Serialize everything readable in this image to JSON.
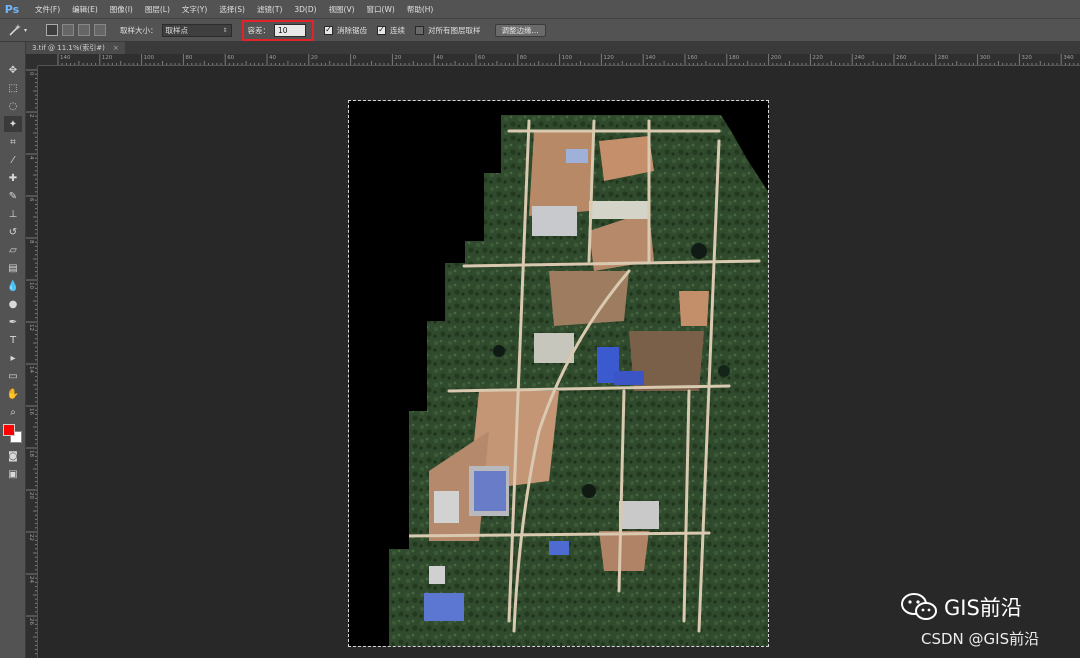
{
  "app": {
    "logo": "Ps"
  },
  "menu": [
    "文件(F)",
    "编辑(E)",
    "图像(I)",
    "图层(L)",
    "文字(Y)",
    "选择(S)",
    "滤镜(T)",
    "3D(D)",
    "视图(V)",
    "窗口(W)",
    "帮助(H)"
  ],
  "options": {
    "tool_icon": "magic-wand-icon",
    "sample_size_label": "取样大小：",
    "sample_size_value": "取样点",
    "tolerance_label": "容差：",
    "tolerance_value": "10",
    "antialias_label": "消除锯齿",
    "antialias_checked": true,
    "contiguous_label": "连续",
    "contiguous_checked": true,
    "sample_all_label": "对所有图层取样",
    "sample_all_checked": false,
    "refine_edge_label": "调整边缘...",
    "highlight_color": "#e1232a"
  },
  "document": {
    "tab_title": "3.tif @ 11.1%(索引#)",
    "close_glyph": "×"
  },
  "ruler_top": [
    "140",
    "120",
    "100",
    "80",
    "60",
    "40",
    "20",
    "0",
    "20",
    "40",
    "60",
    "80",
    "100",
    "120",
    "140",
    "160",
    "180",
    "200",
    "220",
    "240",
    "260",
    "280",
    "300",
    "320",
    "340"
  ],
  "ruler_left": [
    "0",
    "2",
    "4",
    "6",
    "8",
    "10",
    "12",
    "14",
    "16",
    "18",
    "20",
    "22",
    "24",
    "26"
  ],
  "swatches": {
    "foreground": "#ff0000",
    "background": "#ffffff"
  },
  "watermark": {
    "title": "GIS前沿",
    "subtitle": "CSDN @GIS前沿"
  }
}
